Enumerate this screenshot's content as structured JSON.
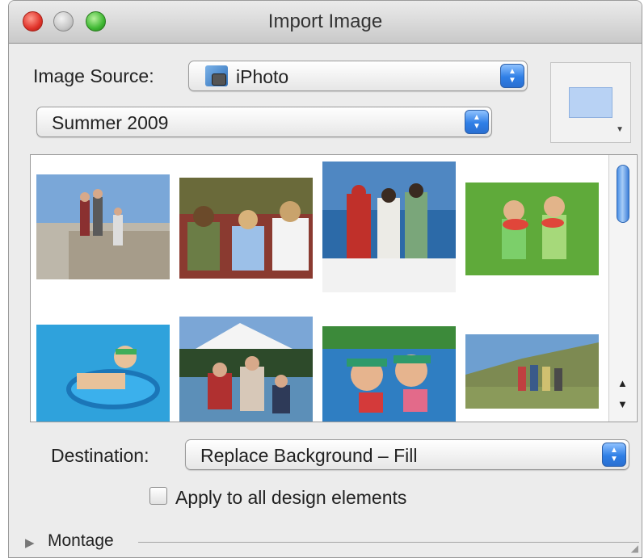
{
  "window": {
    "title": "Import Image"
  },
  "image_source": {
    "label": "Image Source:",
    "value": "iPhoto",
    "icon": "iphoto-icon"
  },
  "album": {
    "value": "Summer 2009"
  },
  "browser": {
    "thumbnails": [
      {
        "name": "hikers-on-stone-wall"
      },
      {
        "name": "children-sitting-on-grass"
      },
      {
        "name": "kids-with-towels-at-lake-dock"
      },
      {
        "name": "girls-eating-watermelon"
      },
      {
        "name": "boy-in-swim-ring"
      },
      {
        "name": "family-by-mountain-lake"
      },
      {
        "name": "kids-in-pool-with-snorkels"
      },
      {
        "name": "group-on-hillside"
      }
    ]
  },
  "destination": {
    "label": "Destination:",
    "value": "Replace Background – Fill"
  },
  "apply_all": {
    "label": "Apply to all design elements",
    "checked": false
  },
  "montage": {
    "label": "Montage"
  },
  "colors": {
    "accent": "#2f7fe6",
    "window_bg": "#ececec"
  }
}
